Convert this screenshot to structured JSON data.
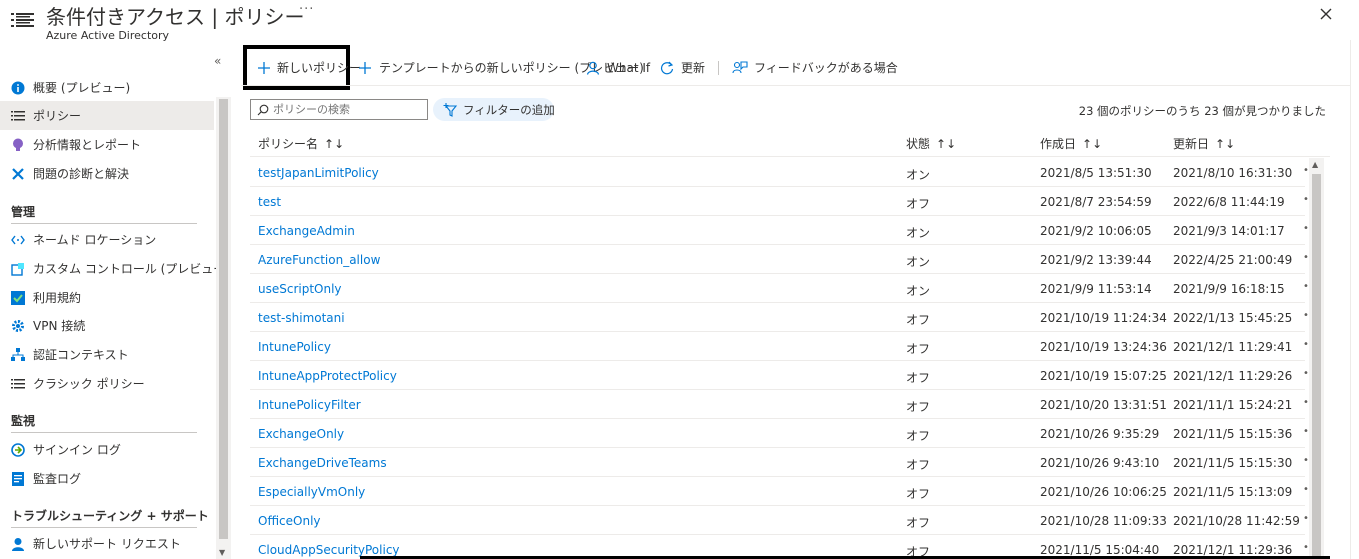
{
  "header": {
    "title": "条件付きアクセス | ポリシー",
    "subtitle": "Azure Active Directory",
    "more": "···"
  },
  "sidebar": {
    "collapse": "«",
    "items": [
      {
        "label": "概要 (プレビュー)",
        "icon": "info-icon",
        "active": false
      },
      {
        "label": "ポリシー",
        "icon": "list-icon",
        "active": true
      },
      {
        "label": "分析情報とレポート",
        "icon": "lightbulb-icon",
        "active": false
      },
      {
        "label": "問題の診断と解決",
        "icon": "wrench-icon",
        "active": false
      }
    ],
    "sections": {
      "manage": {
        "label": "管理",
        "items": [
          {
            "label": "ネームド ロケーション",
            "icon": "network-icon"
          },
          {
            "label": "カスタム コントロール (プレビュー)",
            "icon": "custom-control-icon"
          },
          {
            "label": "利用規約",
            "icon": "checklist-icon"
          },
          {
            "label": "VPN 接続",
            "icon": "gear-icon"
          },
          {
            "label": "認証コンテキスト",
            "icon": "hierarchy-icon"
          },
          {
            "label": "クラシック ポリシー",
            "icon": "list-icon"
          }
        ]
      },
      "monitor": {
        "label": "監視",
        "items": [
          {
            "label": "サインイン ログ",
            "icon": "signin-log-icon"
          },
          {
            "label": "監査ログ",
            "icon": "audit-log-icon"
          }
        ]
      },
      "support": {
        "label": "トラブルシューティング + サポート",
        "items": [
          {
            "label": "新しいサポート リクエスト",
            "icon": "support-person-icon"
          }
        ]
      }
    }
  },
  "toolbar": {
    "new_policy": "新しいポリシー",
    "from_template": "テンプレートからの新しいポリシー (プレビュー)",
    "what_if": "What If",
    "refresh": "更新",
    "feedback": "フィードバックがある場合"
  },
  "filters": {
    "search_placeholder": "ポリシーの検索",
    "add_filter": "フィルターの追加",
    "count_text": "23 個のポリシーのうち 23 個が見つかりました"
  },
  "table": {
    "columns": [
      "ポリシー名",
      "状態",
      "作成日",
      "更新日"
    ],
    "sort_glyph": "↑↓",
    "rows": [
      {
        "name": "testJapanLimitPolicy",
        "state": "オン",
        "created": "2021/8/5 13:51:30",
        "modified": "2021/8/10 16:31:30"
      },
      {
        "name": "test",
        "state": "オフ",
        "created": "2021/8/7 23:54:59",
        "modified": "2022/6/8 11:44:19"
      },
      {
        "name": "ExchangeAdmin",
        "state": "オン",
        "created": "2021/9/2 10:06:05",
        "modified": "2021/9/3 14:01:17"
      },
      {
        "name": "AzureFunction_allow",
        "state": "オン",
        "created": "2021/9/2 13:39:44",
        "modified": "2022/4/25 21:00:49"
      },
      {
        "name": "useScriptOnly",
        "state": "オン",
        "created": "2021/9/9 11:53:14",
        "modified": "2021/9/9 16:18:15"
      },
      {
        "name": "test-shimotani",
        "state": "オフ",
        "created": "2021/10/19 11:24:34",
        "modified": "2022/1/13 15:45:25"
      },
      {
        "name": "IntunePolicy",
        "state": "オフ",
        "created": "2021/10/19 13:24:36",
        "modified": "2021/12/1 11:29:41"
      },
      {
        "name": "IntuneAppProtectPolicy",
        "state": "オフ",
        "created": "2021/10/19 15:07:25",
        "modified": "2021/12/1 11:29:26"
      },
      {
        "name": "IntunePolicyFilter",
        "state": "オフ",
        "created": "2021/10/20 13:31:51",
        "modified": "2021/11/1 15:24:21"
      },
      {
        "name": "ExchangeOnly",
        "state": "オフ",
        "created": "2021/10/26 9:35:29",
        "modified": "2021/11/5 15:15:36"
      },
      {
        "name": "ExchangeDriveTeams",
        "state": "オフ",
        "created": "2021/10/26 9:43:10",
        "modified": "2021/11/5 15:15:30"
      },
      {
        "name": "EspeciallyVmOnly",
        "state": "オフ",
        "created": "2021/10/26 10:06:25",
        "modified": "2021/11/5 15:13:09"
      },
      {
        "name": "OfficeOnly",
        "state": "オフ",
        "created": "2021/10/28 11:09:33",
        "modified": "2021/10/28 11:42:59"
      },
      {
        "name": "CloudAppSecurityPolicy",
        "state": "オフ",
        "created": "2021/11/5 15:04:40",
        "modified": "2021/12/1 11:29:36"
      }
    ]
  },
  "colors": {
    "link": "#0078d4",
    "active_nav": "#edebe9",
    "filter_pill": "#e8f2fc"
  }
}
